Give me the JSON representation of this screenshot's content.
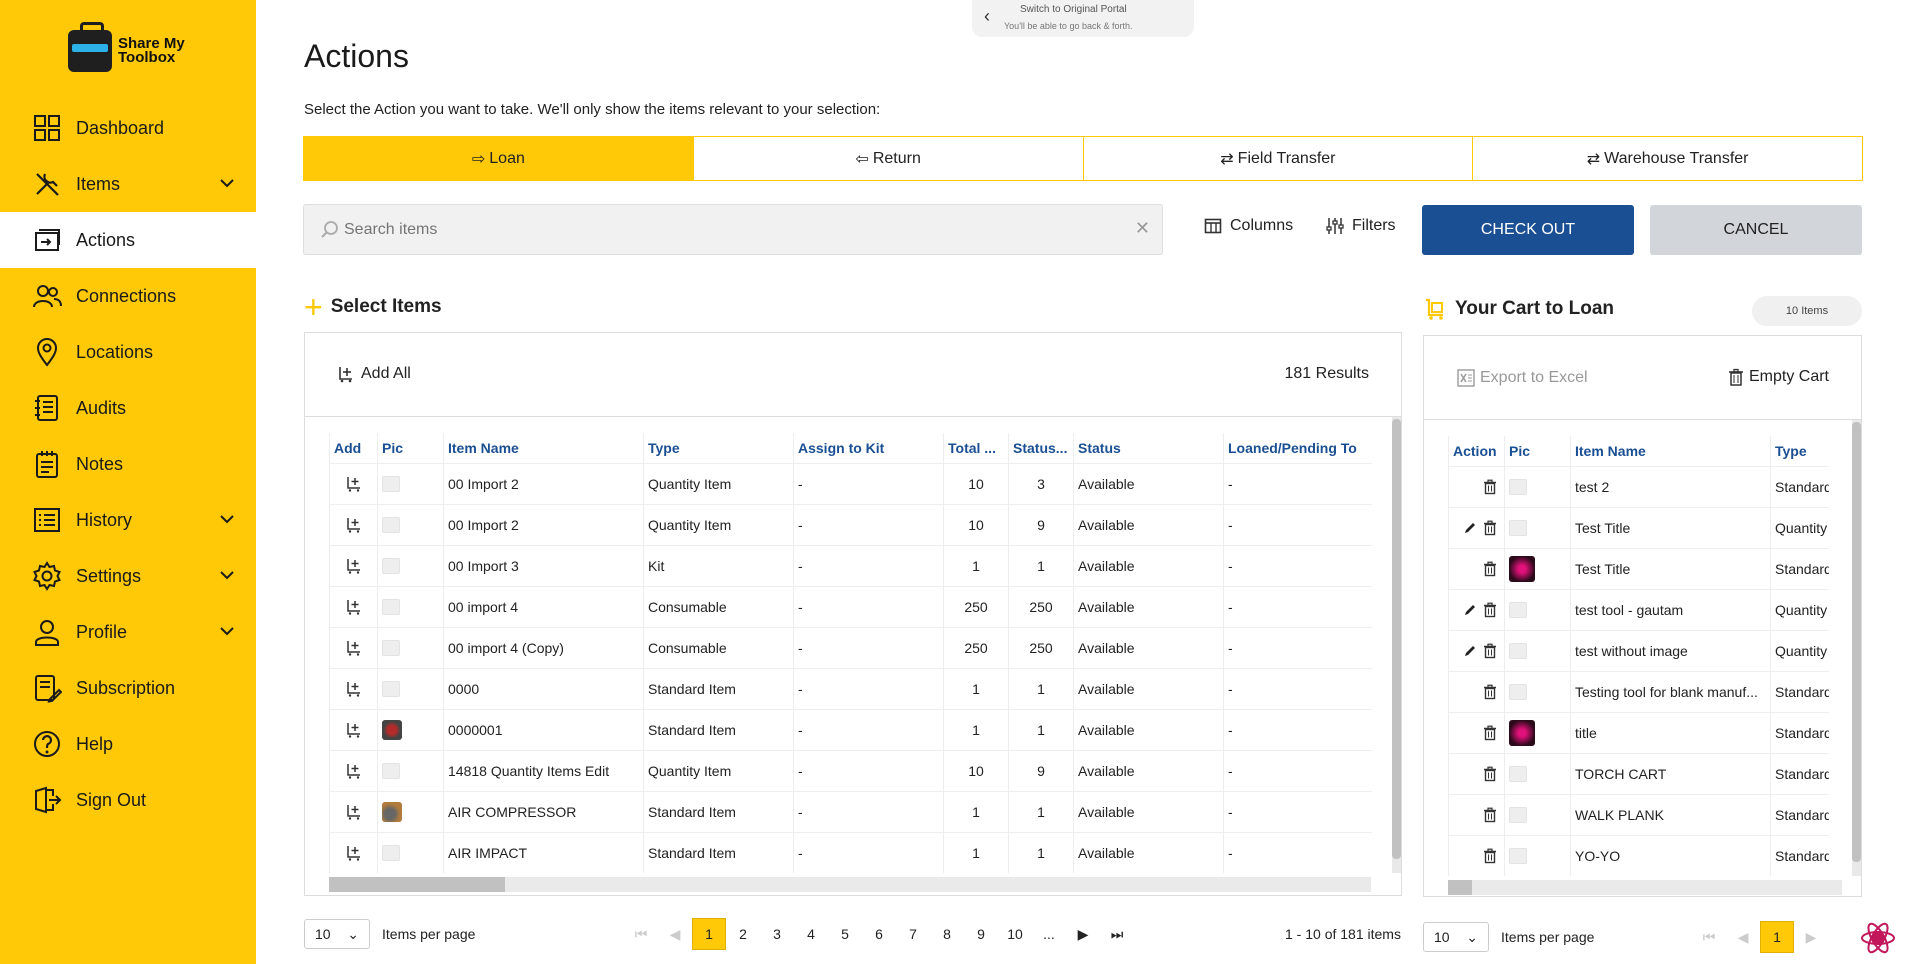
{
  "app": {
    "logo_text": "Share My Toolbox"
  },
  "sidebar": {
    "items": [
      {
        "label": "Dashboard",
        "icon": "grid-icon",
        "active": false,
        "has_chevron": false
      },
      {
        "label": "Items",
        "icon": "tools-icon",
        "active": false,
        "has_chevron": true
      },
      {
        "label": "Actions",
        "icon": "actions-icon",
        "active": true,
        "has_chevron": false
      },
      {
        "label": "Connections",
        "icon": "people-icon",
        "active": false,
        "has_chevron": false
      },
      {
        "label": "Locations",
        "icon": "location-pin-icon",
        "active": false,
        "has_chevron": false
      },
      {
        "label": "Audits",
        "icon": "notebook-icon",
        "active": false,
        "has_chevron": false
      },
      {
        "label": "Notes",
        "icon": "notes-icon",
        "active": false,
        "has_chevron": false
      },
      {
        "label": "History",
        "icon": "history-list-icon",
        "active": false,
        "has_chevron": true
      },
      {
        "label": "Settings",
        "icon": "gear-icon",
        "active": false,
        "has_chevron": true
      },
      {
        "label": "Profile",
        "icon": "user-icon",
        "active": false,
        "has_chevron": true
      },
      {
        "label": "Subscription",
        "icon": "subscription-icon",
        "active": false,
        "has_chevron": false
      },
      {
        "label": "Help",
        "icon": "help-icon",
        "active": false,
        "has_chevron": false
      },
      {
        "label": "Sign Out",
        "icon": "sign-out-icon",
        "active": false,
        "has_chevron": false
      }
    ]
  },
  "portal_switch": {
    "title": "Switch to Original Portal",
    "subtitle": "You'll be able to go back & forth."
  },
  "page": {
    "title": "Actions",
    "subtitle": "Select the Action you want to take. We'll only show the items relevant to your selection:"
  },
  "action_tabs": [
    {
      "label": "Loan",
      "icon": "⇨",
      "active": true
    },
    {
      "label": "Return",
      "icon": "⇦",
      "active": false
    },
    {
      "label": "Field Transfer",
      "icon": "⇄",
      "active": false
    },
    {
      "label": "Warehouse Transfer",
      "icon": "⇄",
      "active": false
    }
  ],
  "search": {
    "placeholder": "Search items",
    "value": ""
  },
  "toolbar": {
    "columns_label": "Columns",
    "filters_label": "Filters",
    "checkout_label": "CHECK OUT",
    "cancel_label": "CANCEL"
  },
  "select_items": {
    "title": "Select Items",
    "add_all_label": "Add All",
    "results_label": "181 Results",
    "columns": [
      "Add",
      "Pic",
      "Item Name",
      "Type",
      "Assign to Kit",
      "Total ...",
      "Status...",
      "Status",
      "Loaned/Pending To"
    ],
    "rows": [
      {
        "pic": "placeholder",
        "name": "00 Import 2",
        "type": "Quantity Item",
        "kit": "-",
        "total": "10",
        "status_qty": "3",
        "status": "Available",
        "loaned": "-"
      },
      {
        "pic": "placeholder",
        "name": "00 Import 2",
        "type": "Quantity Item",
        "kit": "-",
        "total": "10",
        "status_qty": "9",
        "status": "Available",
        "loaned": "-"
      },
      {
        "pic": "placeholder",
        "name": "00 Import 3",
        "type": "Kit",
        "kit": "-",
        "total": "1",
        "status_qty": "1",
        "status": "Available",
        "loaned": "-"
      },
      {
        "pic": "placeholder",
        "name": "00 import 4",
        "type": "Consumable",
        "kit": "-",
        "total": "250",
        "status_qty": "250",
        "status": "Available",
        "loaned": "-"
      },
      {
        "pic": "placeholder",
        "name": "00 import 4 (Copy)",
        "type": "Consumable",
        "kit": "-",
        "total": "250",
        "status_qty": "250",
        "status": "Available",
        "loaned": "-"
      },
      {
        "pic": "placeholder",
        "name": "0000",
        "type": "Standard Item",
        "kit": "-",
        "total": "1",
        "status_qty": "1",
        "status": "Available",
        "loaned": "-"
      },
      {
        "pic": "generator",
        "name": "0000001",
        "type": "Standard Item",
        "kit": "-",
        "total": "1",
        "status_qty": "1",
        "status": "Available",
        "loaned": "-"
      },
      {
        "pic": "placeholder",
        "name": "14818 Quantity Items Edit",
        "type": "Quantity Item",
        "kit": "-",
        "total": "10",
        "status_qty": "9",
        "status": "Available",
        "loaned": "-"
      },
      {
        "pic": "compressor",
        "name": "AIR COMPRESSOR",
        "type": "Standard Item",
        "kit": "-",
        "total": "1",
        "status_qty": "1",
        "status": "Available",
        "loaned": "-"
      },
      {
        "pic": "placeholder",
        "name": "AIR IMPACT",
        "type": "Standard Item",
        "kit": "-",
        "total": "1",
        "status_qty": "1",
        "status": "Available",
        "loaned": "-"
      }
    ],
    "pagination": {
      "per_page": "10",
      "per_page_label": "Items per page",
      "pages": [
        "1",
        "2",
        "3",
        "4",
        "5",
        "6",
        "7",
        "8",
        "9",
        "10"
      ],
      "current": "1",
      "ellipsis": "...",
      "range_label": "1 - 10 of 181 items"
    }
  },
  "cart": {
    "title": "Your Cart to Loan",
    "count_label": "10 Items",
    "export_label": "Export to Excel",
    "empty_label": "Empty Cart",
    "columns": [
      "Action",
      "Pic",
      "Item Name",
      "Type"
    ],
    "rows": [
      {
        "edit": false,
        "pic": "placeholder",
        "name": "test 2",
        "type": "Standard"
      },
      {
        "edit": true,
        "pic": "placeholder",
        "name": "Test Title",
        "type": "Quantity"
      },
      {
        "edit": false,
        "pic": "pink",
        "name": "Test Title",
        "type": "Standard"
      },
      {
        "edit": true,
        "pic": "placeholder",
        "name": "test tool - gautam",
        "type": "Quantity"
      },
      {
        "edit": true,
        "pic": "placeholder",
        "name": "test without image",
        "type": "Quantity"
      },
      {
        "edit": false,
        "pic": "placeholder",
        "name": "Testing tool for blank manuf...",
        "type": "Standard"
      },
      {
        "edit": false,
        "pic": "pink",
        "name": "title",
        "type": "Standard"
      },
      {
        "edit": false,
        "pic": "placeholder",
        "name": "TORCH CART",
        "type": "Standard"
      },
      {
        "edit": false,
        "pic": "placeholder",
        "name": "WALK PLANK",
        "type": "Standard"
      },
      {
        "edit": false,
        "pic": "placeholder",
        "name": "YO-YO",
        "type": "Standard"
      }
    ],
    "pagination": {
      "per_page": "10",
      "per_page_label": "Items per page",
      "current": "1"
    }
  },
  "colors": {
    "brand_yellow": "#FFC907",
    "primary_blue": "#1a4f93",
    "header_blue": "#1a4f93"
  }
}
